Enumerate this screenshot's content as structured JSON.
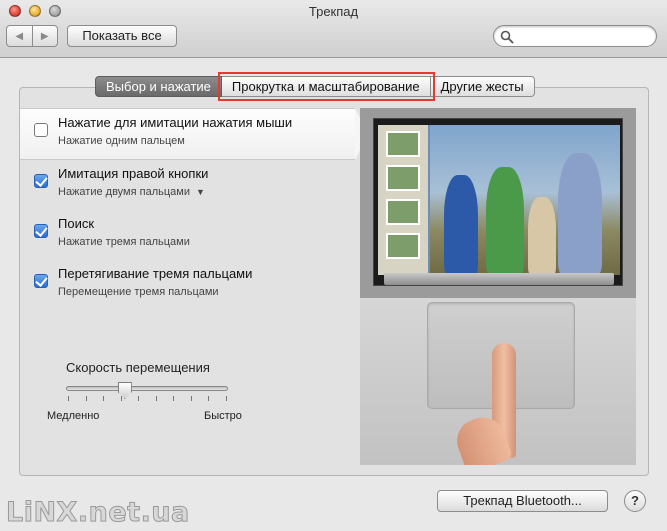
{
  "window": {
    "title": "Трекпад"
  },
  "toolbar": {
    "back_glyph": "◀",
    "forward_glyph": "▶",
    "show_all_label": "Показать все",
    "search_placeholder": ""
  },
  "tabs": [
    {
      "label": "Выбор и нажатие",
      "active": true
    },
    {
      "label": "Прокрутка и масштабирование",
      "active": false,
      "highlighted": true
    },
    {
      "label": "Другие жесты",
      "active": false
    }
  ],
  "options": [
    {
      "title": "Нажатие для имитации нажатия мыши",
      "subtitle": "Нажатие одним пальцем",
      "checked": false,
      "selected": true
    },
    {
      "title": "Имитация правой кнопки",
      "subtitle": "Нажатие двумя пальцами",
      "checked": true,
      "selected": false,
      "has_dropdown": true,
      "dropdown_glyph": "▼"
    },
    {
      "title": "Поиск",
      "subtitle": "Нажатие тремя пальцами",
      "checked": true,
      "selected": false
    },
    {
      "title": "Перетягивание тремя пальцами",
      "subtitle": "Перемещение тремя пальцами",
      "checked": true,
      "selected": false
    }
  ],
  "tracking_speed": {
    "label": "Скорость перемещения",
    "min_label": "Медленно",
    "max_label": "Быстро",
    "value_fraction": 0.35,
    "tick_count": 10
  },
  "footer": {
    "bluetooth_button_label": "Трекпад Bluetooth...",
    "help_label": "?"
  },
  "watermark": "LiNX.net.ua",
  "colors": {
    "accent": "#2b6fd0",
    "highlight": "#e23b32"
  }
}
